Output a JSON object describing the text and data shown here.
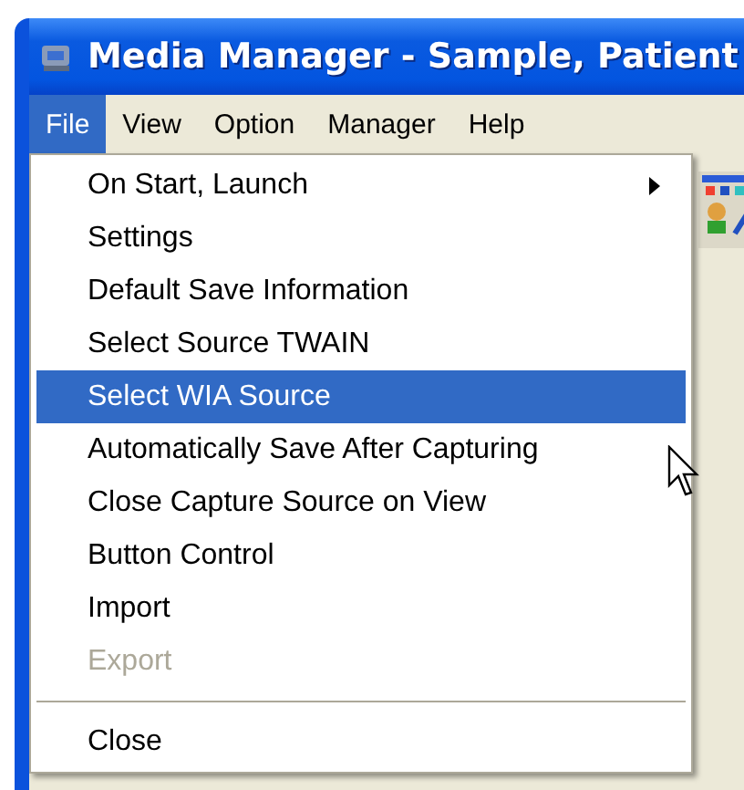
{
  "window": {
    "title": "Media Manager - Sample, Patient"
  },
  "menu_bar": [
    {
      "label": "File",
      "selected": true
    },
    {
      "label": "View",
      "selected": false
    },
    {
      "label": "Option",
      "selected": false
    },
    {
      "label": "Manager",
      "selected": false
    },
    {
      "label": "Help",
      "selected": false
    }
  ],
  "file_menu": [
    {
      "kind": "submenu",
      "label": "On Start, Launch",
      "selected": false,
      "disabled": false
    },
    {
      "kind": "item",
      "label": "Settings",
      "selected": false,
      "disabled": false
    },
    {
      "kind": "item",
      "label": "Default Save Information",
      "selected": false,
      "disabled": false
    },
    {
      "kind": "item",
      "label": "Select Source TWAIN",
      "selected": false,
      "disabled": false
    },
    {
      "kind": "item",
      "label": "Select WIA Source",
      "selected": true,
      "disabled": false
    },
    {
      "kind": "item",
      "label": "Automatically Save After Capturing",
      "selected": false,
      "disabled": false
    },
    {
      "kind": "item",
      "label": "Close Capture Source on View",
      "selected": false,
      "disabled": false
    },
    {
      "kind": "item",
      "label": "Button Control",
      "selected": false,
      "disabled": false
    },
    {
      "kind": "item",
      "label": "Import",
      "selected": false,
      "disabled": false
    },
    {
      "kind": "item",
      "label": "Export",
      "selected": false,
      "disabled": true
    },
    {
      "kind": "separator"
    },
    {
      "kind": "item",
      "label": "Close",
      "selected": false,
      "disabled": false
    }
  ]
}
